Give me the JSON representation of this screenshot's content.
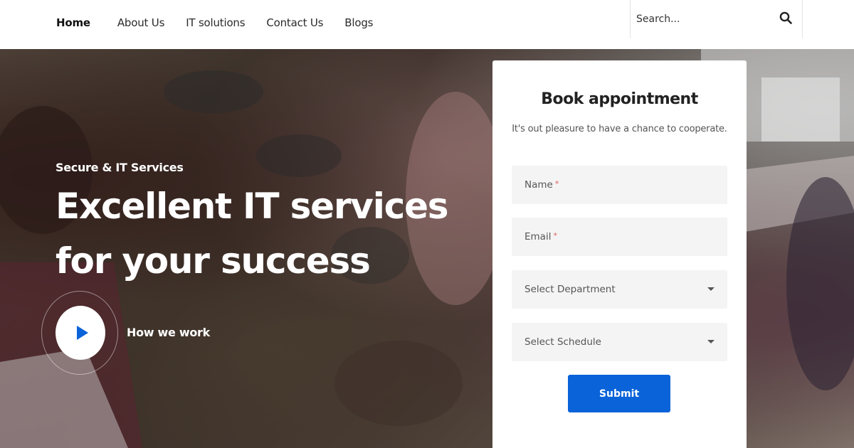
{
  "nav": {
    "items": [
      {
        "label": "Home",
        "active": true
      },
      {
        "label": "About Us"
      },
      {
        "label": "IT solutions"
      },
      {
        "label": "Contact Us"
      },
      {
        "label": "Blogs"
      }
    ]
  },
  "search": {
    "placeholder": "Search...",
    "icon": "search-icon"
  },
  "hero": {
    "eyebrow": "Secure & IT Services",
    "headline_line1": "Excellent IT services",
    "headline_line2": "for your success",
    "play_label": "How we work",
    "play_icon": "play-icon"
  },
  "form": {
    "title": "Book appointment",
    "subtitle": "It's out pleasure to have a chance to cooperate.",
    "name_placeholder": "Name",
    "email_placeholder": "Email",
    "required_mark": "*",
    "department_placeholder": "Select Department",
    "schedule_placeholder": "Select Schedule",
    "submit_label": "Submit"
  },
  "colors": {
    "accent": "#0a63d8",
    "play_icon": "#0a63d8",
    "required": "#e06060"
  }
}
